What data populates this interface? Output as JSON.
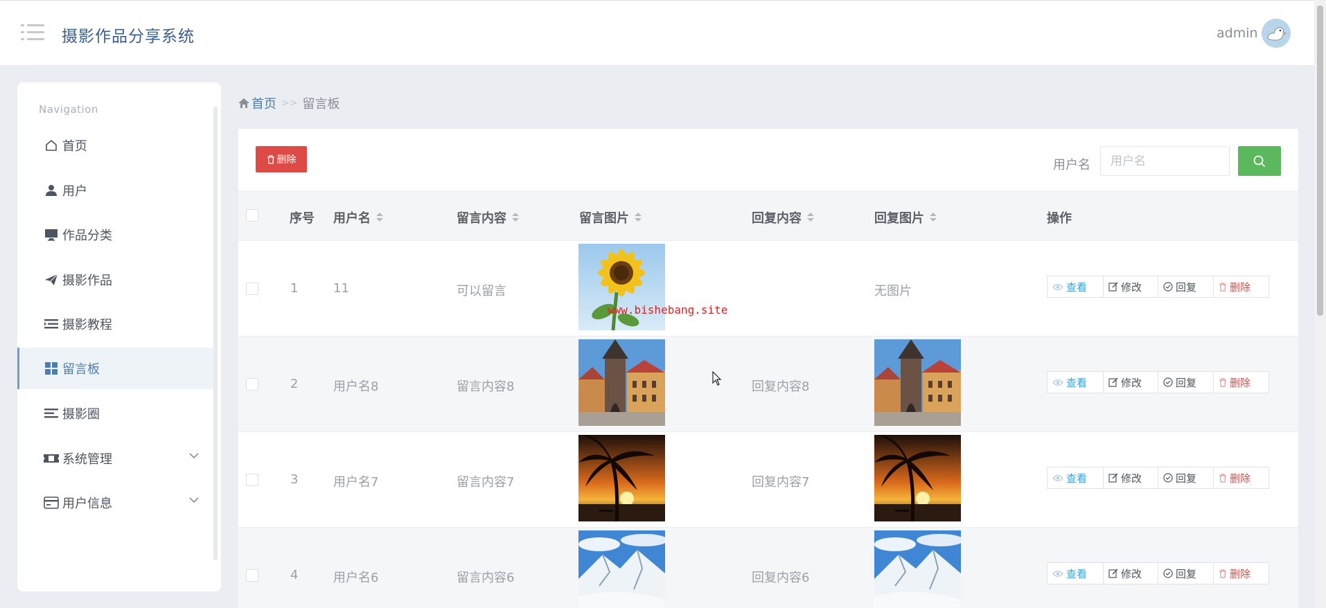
{
  "header": {
    "app_title": "摄影作品分享系统",
    "admin_name": "admin"
  },
  "sidebar": {
    "heading": "Navigation",
    "items": [
      {
        "label": "首页",
        "icon": "home-icon"
      },
      {
        "label": "用户",
        "icon": "user-icon"
      },
      {
        "label": "作品分类",
        "icon": "monitor-icon"
      },
      {
        "label": "摄影作品",
        "icon": "paper-plane-icon"
      },
      {
        "label": "摄影教程",
        "icon": "list-indent-icon"
      },
      {
        "label": "留言板",
        "icon": "grid-icon",
        "active": true
      },
      {
        "label": "摄影圈",
        "icon": "align-icon"
      },
      {
        "label": "系统管理",
        "icon": "ticket-icon",
        "has_submenu": true
      },
      {
        "label": "用户信息",
        "icon": "card-icon",
        "has_submenu": true
      }
    ]
  },
  "breadcrumb": {
    "home": "首页",
    "separator": ">>",
    "current": "留言板"
  },
  "toolbar": {
    "delete_label": "删除",
    "search_label": "用户名",
    "search_placeholder": "用户名",
    "search_value": ""
  },
  "table": {
    "headers": {
      "index": "序号",
      "username": "用户名",
      "content": "留言内容",
      "image": "留言图片",
      "reply": "回复内容",
      "reply_image": "回复图片",
      "actions": "操作"
    },
    "actions": {
      "view": "查看",
      "edit": "修改",
      "reply": "回复",
      "delete": "删除"
    },
    "rows": [
      {
        "index": "1",
        "username": "11",
        "content": "可以留言",
        "image": "sunflower",
        "reply": "",
        "reply_image": "",
        "reply_image_text": "无图片"
      },
      {
        "index": "2",
        "username": "用户名8",
        "content": "留言内容8",
        "image": "old-town-tower",
        "reply": "回复内容8",
        "reply_image": "old-town-tower",
        "reply_image_text": ""
      },
      {
        "index": "3",
        "username": "用户名7",
        "content": "留言内容7",
        "image": "palm-sunset",
        "reply": "回复内容7",
        "reply_image": "palm-sunset",
        "reply_image_text": ""
      },
      {
        "index": "4",
        "username": "用户名6",
        "content": "留言内容6",
        "image": "snowy-mountain",
        "reply": "回复内容6",
        "reply_image": "snowy-mountain",
        "reply_image_text": ""
      }
    ]
  },
  "watermark": "www.bishebang.site",
  "colors": {
    "brand": "#3a5f8a",
    "danger": "#de4b47",
    "success": "#5cb85c",
    "link": "#4a7fb0"
  }
}
